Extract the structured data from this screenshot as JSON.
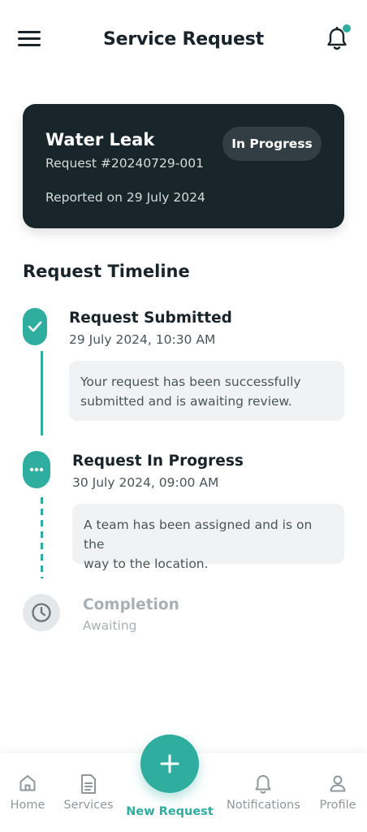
{
  "header": {
    "title": "Service Request"
  },
  "request": {
    "title": "Water Leak",
    "number": "Request #20240729-001",
    "reported": "Reported on 29 July 2024",
    "status": "In Progress"
  },
  "timeline": {
    "heading": "Request Timeline",
    "steps": [
      {
        "title": "Request Submitted",
        "time": "29 July 2024, 10:30 AM",
        "note_line1": "Your request has been successfully",
        "note_line2": "submitted and is awaiting review."
      },
      {
        "title": "Request In Progress",
        "time": "30 July 2024, 09:00 AM",
        "note_line1": "A team has been assigned and is on the",
        "note_line2": "way to the location."
      },
      {
        "title": "Completion",
        "time": "Awaiting"
      }
    ]
  },
  "bottom_nav": {
    "items": [
      {
        "label": "Home",
        "icon": "home-icon"
      },
      {
        "label": "Services",
        "icon": "document-icon"
      },
      {
        "label": "New Request",
        "icon": "plus-icon"
      },
      {
        "label": "Notifications",
        "icon": "bell-icon"
      },
      {
        "label": "Profile",
        "icon": "user-icon"
      }
    ]
  },
  "colors": {
    "accent": "#2faea0",
    "card_bg": "#18252a",
    "badge_bg": "#323e43",
    "muted_text": "#a9b0b4"
  }
}
